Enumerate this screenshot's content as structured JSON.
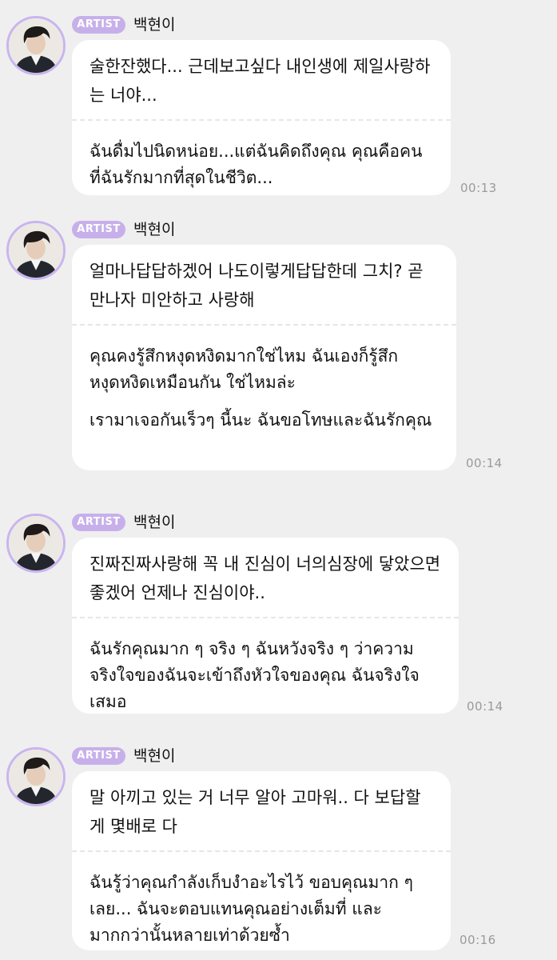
{
  "messages": [
    {
      "badge": "ARTIST",
      "sender": "백현이",
      "korean": "술한잔했다... 근데보고싶다 내인생에 제일사랑하는 너야...",
      "thai": [
        "ฉันดื่มไปนิดหน่อย...แต่ฉันคิดถึงคุณ คุณคือคนที่ฉันรักมากที่สุดในชีวิต..."
      ],
      "time": "00:13"
    },
    {
      "badge": "ARTIST",
      "sender": "백현이",
      "korean": "얼마나답답하겠어 나도이렇게답답한데 그치? 곧 만나자 미안하고 사랑해",
      "thai": [
        "คุณคงรู้สึกหงุดหงิดมากใช่ไหม ฉันเองก็รู้สึกหงุดหงิดเหมือนกัน ใช่ไหมล่ะ",
        "เรามาเจอกันเร็วๆ นี้นะ ฉันขอโทษและฉันรักคุณ"
      ],
      "time": "00:14"
    },
    {
      "badge": "ARTIST",
      "sender": "백현이",
      "korean": "진짜진짜사랑해 꼭 내 진심이 너의심장에 닿았으면 좋겠어 언제나 진심이야..",
      "thai": [
        "ฉันรักคุณมาก ๆ จริง ๆ ฉันหวังจริง ๆ ว่าความจริงใจของฉันจะเข้าถึงหัวใจของคุณ ฉันจริงใจเสมอ"
      ],
      "time": "00:14"
    },
    {
      "badge": "ARTIST",
      "sender": "백현이",
      "korean": "말 아끼고 있는 거 너무 알아 고마워.. 다 보답할게 몇배로 다",
      "thai": [
        "ฉันรู้ว่าคุณกำลังเก็บงำอะไรไว้ ขอบคุณมาก ๆ เลย... ฉันจะตอบแทนคุณอย่างเต็มที่ และมากกว่านั้นหลายเท่าด้วยซ้ำ"
      ],
      "time": "00:16"
    }
  ]
}
